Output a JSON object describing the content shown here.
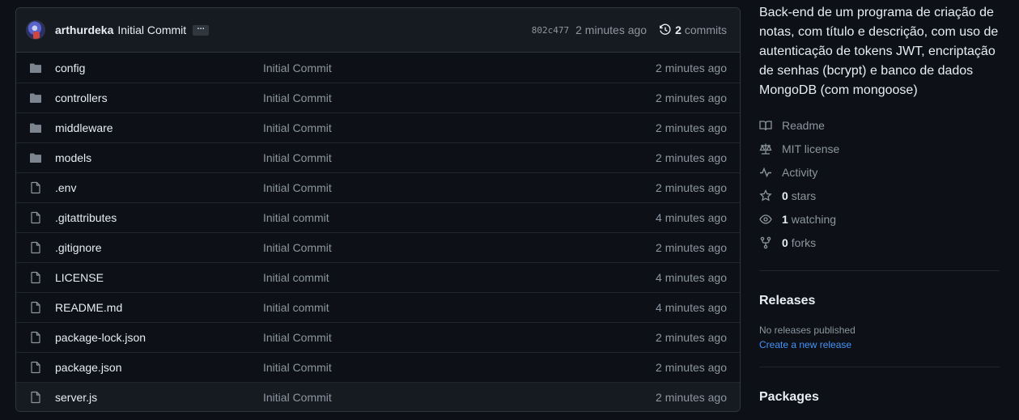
{
  "latest_commit": {
    "author": "arthurdeka",
    "message": "Initial Commit",
    "ellipsis": "…",
    "sha": "802c477",
    "time": "2 minutes ago",
    "commits_count": "2",
    "commits_label": "commits"
  },
  "files": [
    {
      "name": "config",
      "type": "folder",
      "commit": "Initial Commit",
      "age": "2 minutes ago"
    },
    {
      "name": "controllers",
      "type": "folder",
      "commit": "Initial Commit",
      "age": "2 minutes ago"
    },
    {
      "name": "middleware",
      "type": "folder",
      "commit": "Initial Commit",
      "age": "2 minutes ago"
    },
    {
      "name": "models",
      "type": "folder",
      "commit": "Initial Commit",
      "age": "2 minutes ago"
    },
    {
      "name": ".env",
      "type": "file",
      "commit": "Initial Commit",
      "age": "2 minutes ago"
    },
    {
      "name": ".gitattributes",
      "type": "file",
      "commit": "Initial commit",
      "age": "4 minutes ago"
    },
    {
      "name": ".gitignore",
      "type": "file",
      "commit": "Initial Commit",
      "age": "2 minutes ago"
    },
    {
      "name": "LICENSE",
      "type": "file",
      "commit": "Initial commit",
      "age": "4 minutes ago"
    },
    {
      "name": "README.md",
      "type": "file",
      "commit": "Initial commit",
      "age": "4 minutes ago"
    },
    {
      "name": "package-lock.json",
      "type": "file",
      "commit": "Initial Commit",
      "age": "2 minutes ago"
    },
    {
      "name": "package.json",
      "type": "file",
      "commit": "Initial Commit",
      "age": "2 minutes ago"
    },
    {
      "name": "server.js",
      "type": "file",
      "commit": "Initial Commit",
      "age": "2 minutes ago"
    }
  ],
  "sidebar": {
    "about": "Back-end de um programa de criação de notas, com título e descrição, com uso de autenticação de tokens JWT, encriptação de senhas (bcrypt) e banco de dados MongoDB (com mongoose)",
    "readme": "Readme",
    "license": "MIT license",
    "activity": "Activity",
    "stars_count": "0",
    "stars_label": "stars",
    "watching_count": "1",
    "watching_label": "watching",
    "forks_count": "0",
    "forks_label": "forks",
    "releases_title": "Releases",
    "no_releases": "No releases published",
    "create_release": "Create a new release",
    "packages_title": "Packages"
  },
  "colors": {
    "background": "#0d1117",
    "border": "#30363d",
    "muted": "#8d96a0",
    "link": "#4493f8",
    "folder_icon": "#7d8590"
  }
}
